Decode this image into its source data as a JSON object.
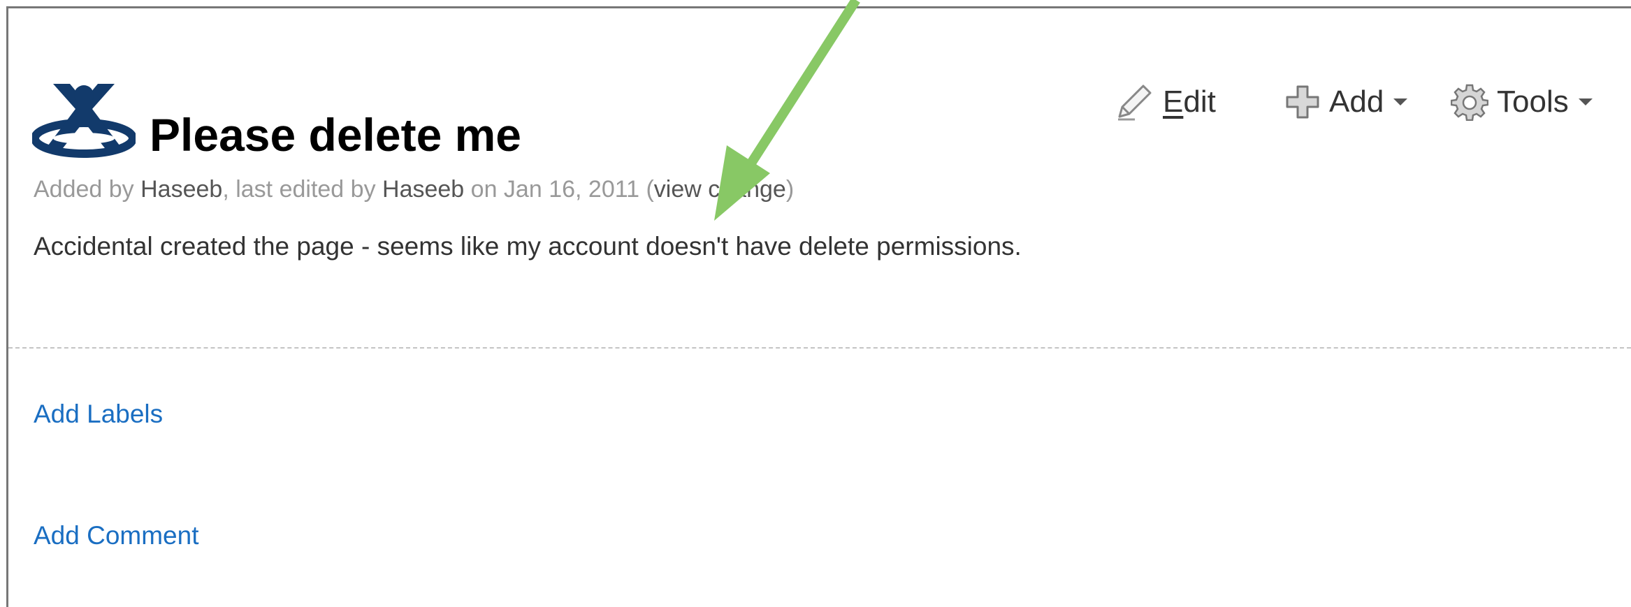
{
  "page": {
    "title": "Please delete me",
    "byline": {
      "added_prefix": "Added by ",
      "added_user": "Haseeb",
      "edited_prefix": ", last edited by ",
      "edited_user": "Haseeb",
      "date_text": " on Jan 16, 2011  (",
      "view_change": "view change",
      "close_paren": ")"
    },
    "body": "Accidental created the page - seems like my account doesn't have delete permissions."
  },
  "toolbar": {
    "edit_underlined": "E",
    "edit_rest": "dit",
    "add_label": "Add",
    "tools_label": "Tools",
    "icons": [
      "pencil-icon",
      "plus-icon",
      "gear-icon",
      "caret-down-icon"
    ]
  },
  "links": {
    "add_labels": "Add Labels",
    "add_comment": "Add Comment"
  },
  "annotation": {
    "arrow_color": "#88c865"
  },
  "colors": {
    "link": "#1a6ec2",
    "logo": "#123a6b",
    "muted": "#999999"
  }
}
